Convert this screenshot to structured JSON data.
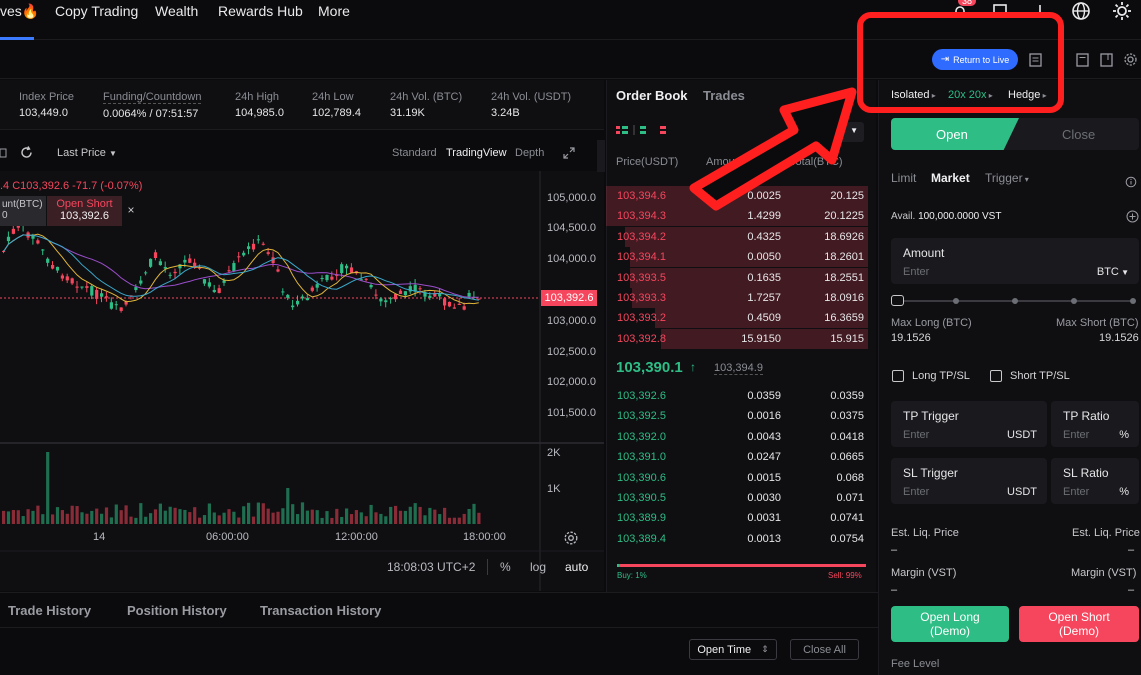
{
  "nav": {
    "items": [
      "ves🔥",
      "Copy Trading",
      "Wealth",
      "Rewards Hub",
      "More"
    ],
    "badge": "38"
  },
  "subbar": {
    "return_live": "Return to Live"
  },
  "ticker": {
    "index_price_label": "Index Price",
    "index_price": "103,449.0",
    "funding_label": "Funding/Countdown",
    "funding": "0.0064% / 07:51:57",
    "high_label": "24h High",
    "high": "104,985.0",
    "low_label": "24h Low",
    "low": "102,789.4",
    "vol_btc_label": "24h Vol. (BTC)",
    "vol_btc": "31.19K",
    "vol_usdt_label": "24h Vol. (USDT)",
    "vol_usdt": "3.24B"
  },
  "chart_toolbar": {
    "last_price": "Last Price",
    "standard": "Standard",
    "tradingview": "TradingView",
    "depth": "Depth"
  },
  "chart": {
    "ohlc_text": ".4  C103,392.6  -71.7 (-0.07%)",
    "left_box_line1": "unt(BTC)",
    "left_box_line2": "0",
    "open_short_label": "Open Short",
    "open_short_price": "103,392.6",
    "close_x": "×",
    "price_tag": "103,392.6",
    "yticks": [
      "105,000.0",
      "104,500.0",
      "104,000.0",
      "103,000.0",
      "102,500.0",
      "102,000.0",
      "101,500.0"
    ],
    "vol_ticks": [
      "2K",
      "1K"
    ],
    "xticks": [
      "14",
      "06:00:00",
      "12:00:00",
      "18:00:00"
    ],
    "time": "18:08:03 UTC+2",
    "pct": "%",
    "log": "log",
    "auto": "auto"
  },
  "bottom": {
    "tabs": [
      "Trade History",
      "Position History",
      "Transaction History"
    ],
    "open_time": "Open Time",
    "close_all": "Close All"
  },
  "orderbook": {
    "tab_book": "Order Book",
    "tab_trades": "Trades",
    "step": "0.1",
    "col_price": "Price(USDT)",
    "col_amount": "Amount(BTC)",
    "col_total": "Total(BTC)",
    "asks": [
      {
        "p": "103,394.6",
        "a": "0.0025",
        "t": "20.125"
      },
      {
        "p": "103,394.3",
        "a": "1.4299",
        "t": "20.1225"
      },
      {
        "p": "103,394.2",
        "a": "0.4325",
        "t": "18.6926"
      },
      {
        "p": "103,394.1",
        "a": "0.0050",
        "t": "18.2601"
      },
      {
        "p": "103,393.5",
        "a": "0.1635",
        "t": "18.2551"
      },
      {
        "p": "103,393.3",
        "a": "1.7257",
        "t": "18.0916"
      },
      {
        "p": "103,393.2",
        "a": "0.4509",
        "t": "16.3659"
      },
      {
        "p": "103,392.8",
        "a": "15.9150",
        "t": "15.915"
      }
    ],
    "last_price": "103,390.1",
    "mark_price": "103,394.9",
    "bids": [
      {
        "p": "103,392.6",
        "a": "0.0359",
        "t": "0.0359"
      },
      {
        "p": "103,392.5",
        "a": "0.0016",
        "t": "0.0375"
      },
      {
        "p": "103,392.0",
        "a": "0.0043",
        "t": "0.0418"
      },
      {
        "p": "103,391.0",
        "a": "0.0247",
        "t": "0.0665"
      },
      {
        "p": "103,390.6",
        "a": "0.0015",
        "t": "0.068"
      },
      {
        "p": "103,390.5",
        "a": "0.0030",
        "t": "0.071"
      },
      {
        "p": "103,389.9",
        "a": "0.0031",
        "t": "0.0741"
      },
      {
        "p": "103,389.4",
        "a": "0.0013",
        "t": "0.0754"
      }
    ],
    "buy_pct": "Buy: 1%",
    "sell_pct": "Sell: 99%"
  },
  "panel": {
    "isolated": "Isolated",
    "leverage": "20x 20x",
    "hedge": "Hedge",
    "open": "Open",
    "close": "Close",
    "limit": "Limit",
    "market": "Market",
    "trigger": "Trigger",
    "avail_label": "Avail.",
    "avail_value": "100,000.0000 VST",
    "amount_label": "Amount",
    "enter": "Enter",
    "unit_btc": "BTC",
    "max_long_label": "Max Long (BTC)",
    "max_long": "19.1526",
    "max_short_label": "Max Short (BTC)",
    "max_short": "19.1526",
    "long_tpsl": "Long TP/SL",
    "short_tpsl": "Short TP/SL",
    "tp_trigger": "TP Trigger",
    "tp_ratio": "TP Ratio",
    "sl_trigger": "SL Trigger",
    "sl_ratio": "SL Ratio",
    "usdt": "USDT",
    "pct": "%",
    "est_liq": "Est. Liq. Price",
    "dash": "–",
    "margin": "Margin (VST)",
    "open_long_line1": "Open Long",
    "open_long_line2": "(Demo)",
    "open_short_line1": "Open Short",
    "open_short_line2": "(Demo)",
    "fee_level": "Fee Level"
  },
  "colors": {
    "accent_blue": "#2f6bff",
    "green": "#2ebd85",
    "red": "#f6465d",
    "annotation_red": "#ff1f1f"
  }
}
